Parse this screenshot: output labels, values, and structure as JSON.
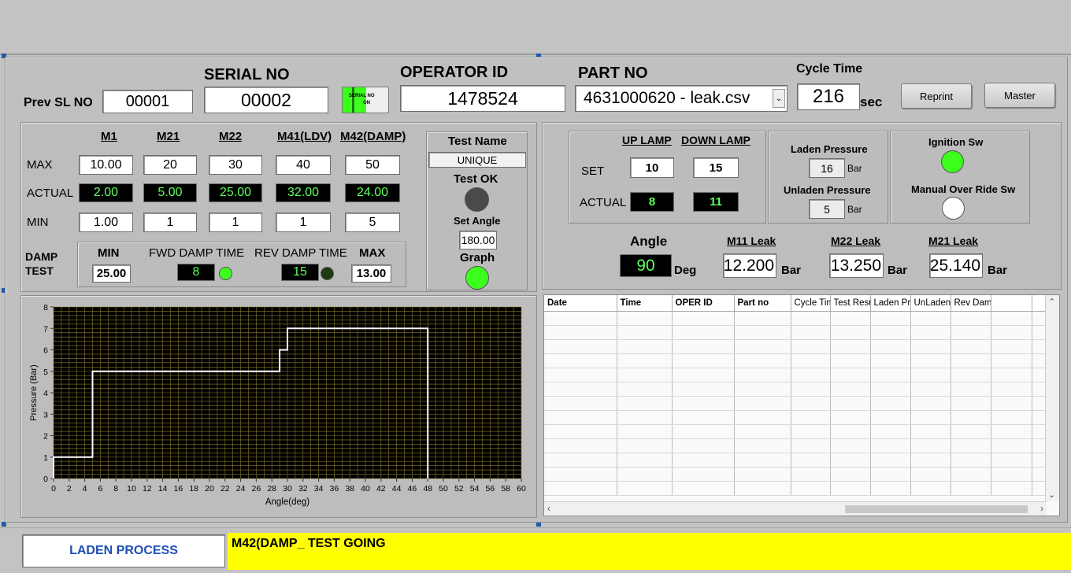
{
  "header": {
    "prev_sl_label": "Prev SL NO",
    "prev_sl_value": "00001",
    "serial_label": "SERIAL NO",
    "serial_value": "00002",
    "serial_indicator_line1": "SERIAL NO",
    "serial_indicator_line2": "ON",
    "operator_label": "OPERATOR ID",
    "operator_value": "1478524",
    "part_label": "PART NO",
    "part_value": "4631000620 - leak.csv",
    "cycle_label": "Cycle Time",
    "cycle_value": "216",
    "cycle_unit": "sec",
    "reprint_label": "Reprint",
    "master_label": "Master"
  },
  "limits": {
    "columns": [
      "M1",
      "M21",
      "M22",
      "M41(LDV)",
      "M42(DAMP)"
    ],
    "max_label": "MAX",
    "actual_label": "ACTUAL",
    "min_label": "MIN",
    "max": [
      "10.00",
      "20",
      "30",
      "40",
      "50"
    ],
    "actual": [
      "2.00",
      "5.00",
      "25.00",
      "32.00",
      "24.00"
    ],
    "min": [
      "1.00",
      "1",
      "1",
      "1",
      "5"
    ]
  },
  "damp": {
    "label_line1": "DAMP",
    "label_line2": "TEST",
    "min_label": "MIN",
    "min_value": "25.00",
    "fwd_label": "FWD DAMP TIME",
    "fwd_value": "8",
    "rev_label": "REV DAMP TIME",
    "rev_value": "15",
    "max_label": "MAX",
    "max_value": "13.00",
    "fwd_led_color": "#3cff1e",
    "rev_led_color": "#1e3a14"
  },
  "test": {
    "name_label": "Test Name",
    "name_value": "UNIQUE",
    "ok_label": "Test OK",
    "set_angle_label": "Set Angle",
    "set_angle_value": "180.00",
    "graph_label": "Graph",
    "ok_led_color": "#4a4a4a",
    "graph_led_color": "#3cff1e"
  },
  "lamps": {
    "up_label": "UP LAMP",
    "down_label": "DOWN LAMP",
    "set_label": "SET",
    "actual_label": "ACTUAL",
    "up_set": "10",
    "down_set": "15",
    "up_actual": "8",
    "down_actual": "11"
  },
  "pressure": {
    "laden_label": "Laden Pressure",
    "laden_value": "16",
    "laden_unit": "Bar",
    "unladen_label": "Unladen  Pressure",
    "unladen_value": "5",
    "unladen_unit": "Bar"
  },
  "switches": {
    "ignition_label": "Ignition Sw",
    "ignition_color": "#3cff1e",
    "override_label": "Manual Over Ride Sw",
    "override_color": "#ffffff"
  },
  "readings": {
    "angle_label": "Angle",
    "angle_value": "90",
    "angle_unit": "Deg",
    "m11_label": "M11 Leak",
    "m11_value": "12.200",
    "m11_unit": "Bar",
    "m22_label": "M22 Leak",
    "m22_value": "13.250",
    "m22_unit": "Bar",
    "m21_label": "M21 Leak",
    "m21_value": "25.140",
    "m21_unit": "Bar"
  },
  "log_table": {
    "columns": [
      "Date",
      "Time",
      "OPER ID",
      "Part no",
      "Cycle Time",
      "Test Result",
      "Laden Pressure",
      "UnLaden Pressure",
      "Rev Damp",
      "",
      ""
    ]
  },
  "status": {
    "process_label": "LADEN PROCESS",
    "message": "M42(DAMP_ TEST GOING",
    "message_bg": "#ffff00",
    "process_color": "#1e4fb4"
  },
  "chart_data": {
    "type": "line",
    "xlabel": "Angle(deg)",
    "ylabel": "Pressure (Bar)",
    "xlim": [
      0,
      60
    ],
    "ylim": [
      0,
      8
    ],
    "xticks": [
      0,
      2,
      4,
      6,
      8,
      10,
      12,
      14,
      16,
      18,
      20,
      22,
      24,
      26,
      28,
      30,
      32,
      34,
      36,
      38,
      40,
      42,
      44,
      46,
      48,
      50,
      52,
      54,
      56,
      58,
      60
    ],
    "yticks": [
      0,
      1,
      2,
      3,
      4,
      5,
      6,
      7,
      8
    ],
    "grid": true,
    "series": [
      {
        "x": [
          0,
          0,
          5,
          5,
          29,
          29,
          30,
          30,
          48,
          48
        ],
        "y": [
          0,
          1,
          1,
          5,
          5,
          6,
          6,
          7,
          7,
          0
        ]
      }
    ]
  }
}
